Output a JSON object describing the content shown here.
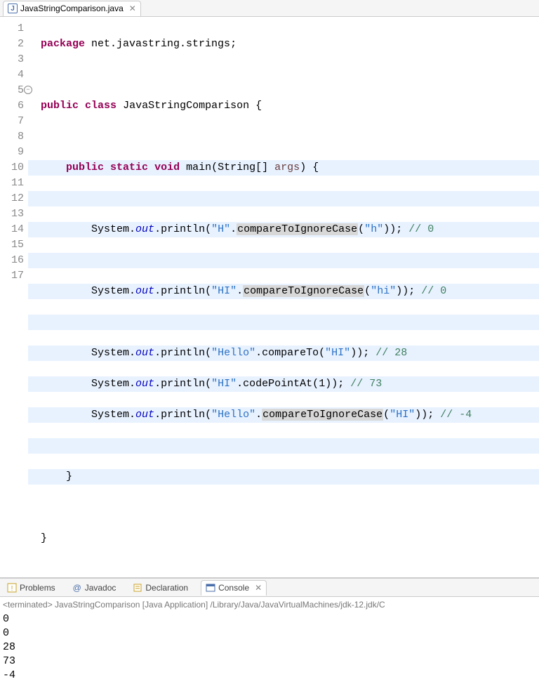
{
  "editor": {
    "tab": {
      "filename": "JavaStringComparison.java"
    },
    "lines": [
      {
        "n": 1,
        "fold": false,
        "hl": false
      },
      {
        "n": 2,
        "fold": false,
        "hl": false
      },
      {
        "n": 3,
        "fold": false,
        "hl": false
      },
      {
        "n": 4,
        "fold": false,
        "hl": false
      },
      {
        "n": 5,
        "fold": true,
        "hl": true
      },
      {
        "n": 6,
        "fold": false,
        "hl": true
      },
      {
        "n": 7,
        "fold": false,
        "hl": true
      },
      {
        "n": 8,
        "fold": false,
        "hl": true
      },
      {
        "n": 9,
        "fold": false,
        "hl": true
      },
      {
        "n": 10,
        "fold": false,
        "hl": true
      },
      {
        "n": 11,
        "fold": false,
        "hl": true
      },
      {
        "n": 12,
        "fold": false,
        "hl": true
      },
      {
        "n": 13,
        "fold": false,
        "hl": true
      },
      {
        "n": 14,
        "fold": false,
        "hl": true
      },
      {
        "n": 15,
        "fold": false,
        "hl": true
      },
      {
        "n": 16,
        "fold": false,
        "hl": false
      },
      {
        "n": 17,
        "fold": false,
        "hl": false
      }
    ],
    "tokens": {
      "package": "package",
      "public": "public",
      "class": "class",
      "static": "static",
      "void": "void",
      "out": "out",
      "main": "main",
      "println": "println",
      "cmpIgn": "compareToIgnoreCase",
      "cmp": "compareTo",
      "cpa": "codePointAt",
      "pkg_name": "net.javastring.strings",
      "class_name": "JavaStringComparison",
      "args_type": "String[]",
      "args_name": "args",
      "system": "System"
    },
    "strings": {
      "H": "\"H\"",
      "h": "\"h\"",
      "HI_u": "\"HI\"",
      "hi_l": "\"hi\"",
      "Hello": "\"Hello\"",
      "one": "1"
    },
    "comments": {
      "c0": "// 0",
      "c0b": "// 0",
      "c28": "// 28",
      "c73": "// 73",
      "cm4": "// -4"
    }
  },
  "bottom_tabs": {
    "items": [
      {
        "label": "Problems"
      },
      {
        "label": "Javadoc"
      },
      {
        "label": "Declaration"
      },
      {
        "label": "Console"
      }
    ],
    "active": 3
  },
  "console": {
    "status": "<terminated> JavaStringComparison [Java Application] /Library/Java/JavaVirtualMachines/jdk-12.jdk/C",
    "output": [
      "0",
      "0",
      "28",
      "73",
      "-4"
    ]
  }
}
